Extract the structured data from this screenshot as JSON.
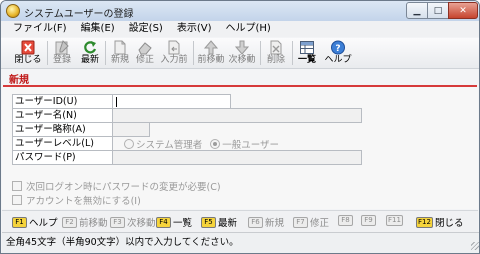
{
  "window": {
    "title": "システムユーザーの登録"
  },
  "menu": [
    "ファイル(F)",
    "編集(E)",
    "設定(S)",
    "表示(V)",
    "ヘルプ(H)"
  ],
  "toolbar": [
    {
      "label": "閉じる",
      "icon": "close-doc-icon",
      "enabled": true
    },
    {
      "label": "登録",
      "icon": "register-icon",
      "enabled": false
    },
    {
      "label": "最新",
      "icon": "refresh-icon",
      "enabled": true
    },
    {
      "label": "新規",
      "icon": "new-doc-icon",
      "enabled": false
    },
    {
      "label": "修正",
      "icon": "eraser-icon",
      "enabled": false
    },
    {
      "label": "入力前",
      "icon": "before-input-icon",
      "enabled": false
    },
    {
      "label": "前移動",
      "icon": "arrow-up-icon",
      "enabled": false
    },
    {
      "label": "次移動",
      "icon": "arrow-down-icon",
      "enabled": false
    },
    {
      "label": "削除",
      "icon": "delete-icon",
      "enabled": false
    },
    {
      "label": "一覧",
      "icon": "list-icon",
      "enabled": true
    },
    {
      "label": "ヘルプ",
      "icon": "help-icon",
      "enabled": true
    }
  ],
  "mode_tab": "新規",
  "form": {
    "fields": [
      {
        "label": "ユーザーID(U)",
        "value": ""
      },
      {
        "label": "ユーザー名(N)",
        "value": ""
      },
      {
        "label": "ユーザー略称(A)",
        "value": ""
      },
      {
        "label": "ユーザーレベル(L)",
        "value": ""
      },
      {
        "label": "パスワード(P)",
        "value": ""
      }
    ],
    "level_options": [
      "システム管理者",
      "一般ユーザー"
    ],
    "level_selected": "一般ユーザー",
    "checkboxes": [
      {
        "label": "次回ログオン時にパスワードの変更が必要(C)",
        "checked": false
      },
      {
        "label": "アカウントを無効にする(I)",
        "checked": false
      }
    ]
  },
  "fkeys": [
    {
      "key": "F1",
      "label": "ヘルプ",
      "enabled": true
    },
    {
      "key": "F2",
      "label": "前移動",
      "enabled": false
    },
    {
      "key": "F3",
      "label": "次移動",
      "enabled": false
    },
    {
      "key": "F4",
      "label": "一覧",
      "enabled": true
    },
    {
      "key": "F5",
      "label": "最新",
      "enabled": true
    },
    {
      "key": "F6",
      "label": "新規",
      "enabled": false
    },
    {
      "key": "F7",
      "label": "修正",
      "enabled": false
    },
    {
      "key": "F8",
      "label": "",
      "enabled": false
    },
    {
      "key": "F9",
      "label": "",
      "enabled": false
    },
    {
      "key": "F11",
      "label": "",
      "enabled": false
    },
    {
      "key": "F12",
      "label": "閉じる",
      "enabled": true
    }
  ],
  "status": "全角45文字（半角90文字）以内で入力してください。",
  "colors": {
    "mode_tab": "#c01818",
    "accent_line": "#d63a3a",
    "fkey_badge": "#fff7c9"
  }
}
